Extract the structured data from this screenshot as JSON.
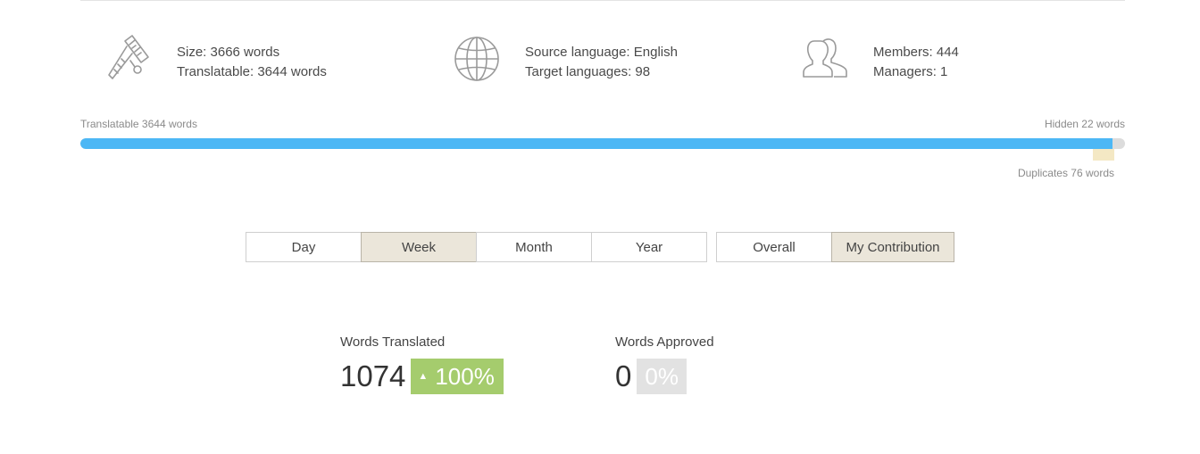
{
  "stats": {
    "size": "Size: 3666 words",
    "translatable": "Translatable: 3644 words",
    "source_language": "Source language: English",
    "target_languages": "Target languages: 98",
    "members": "Members: 444",
    "managers": "Managers: 1"
  },
  "icons": {
    "size": "caliper-icon",
    "language": "globe-icon",
    "members": "users-icon"
  },
  "progress": {
    "translatable_label": "Translatable 3644 words",
    "hidden_label": "Hidden 22 words",
    "duplicates_label": "Duplicates 76 words",
    "translatable_fraction": 0.988,
    "color": "#4cb7f5",
    "duplicates_color": "#f4e8c4"
  },
  "period_tabs": [
    {
      "label": "Day",
      "active": false
    },
    {
      "label": "Week",
      "active": true
    },
    {
      "label": "Month",
      "active": false
    },
    {
      "label": "Year",
      "active": false
    }
  ],
  "scope_tabs": [
    {
      "label": "Overall",
      "active": false
    },
    {
      "label": "My Contribution",
      "active": true
    }
  ],
  "metrics": {
    "translated": {
      "label": "Words Translated",
      "value": "1074",
      "badge": "100%",
      "trend": "up",
      "badge_color": "#a5cc6d"
    },
    "approved": {
      "label": "Words Approved",
      "value": "0",
      "badge": "0%",
      "badge_color": "#e2e2e2"
    }
  }
}
